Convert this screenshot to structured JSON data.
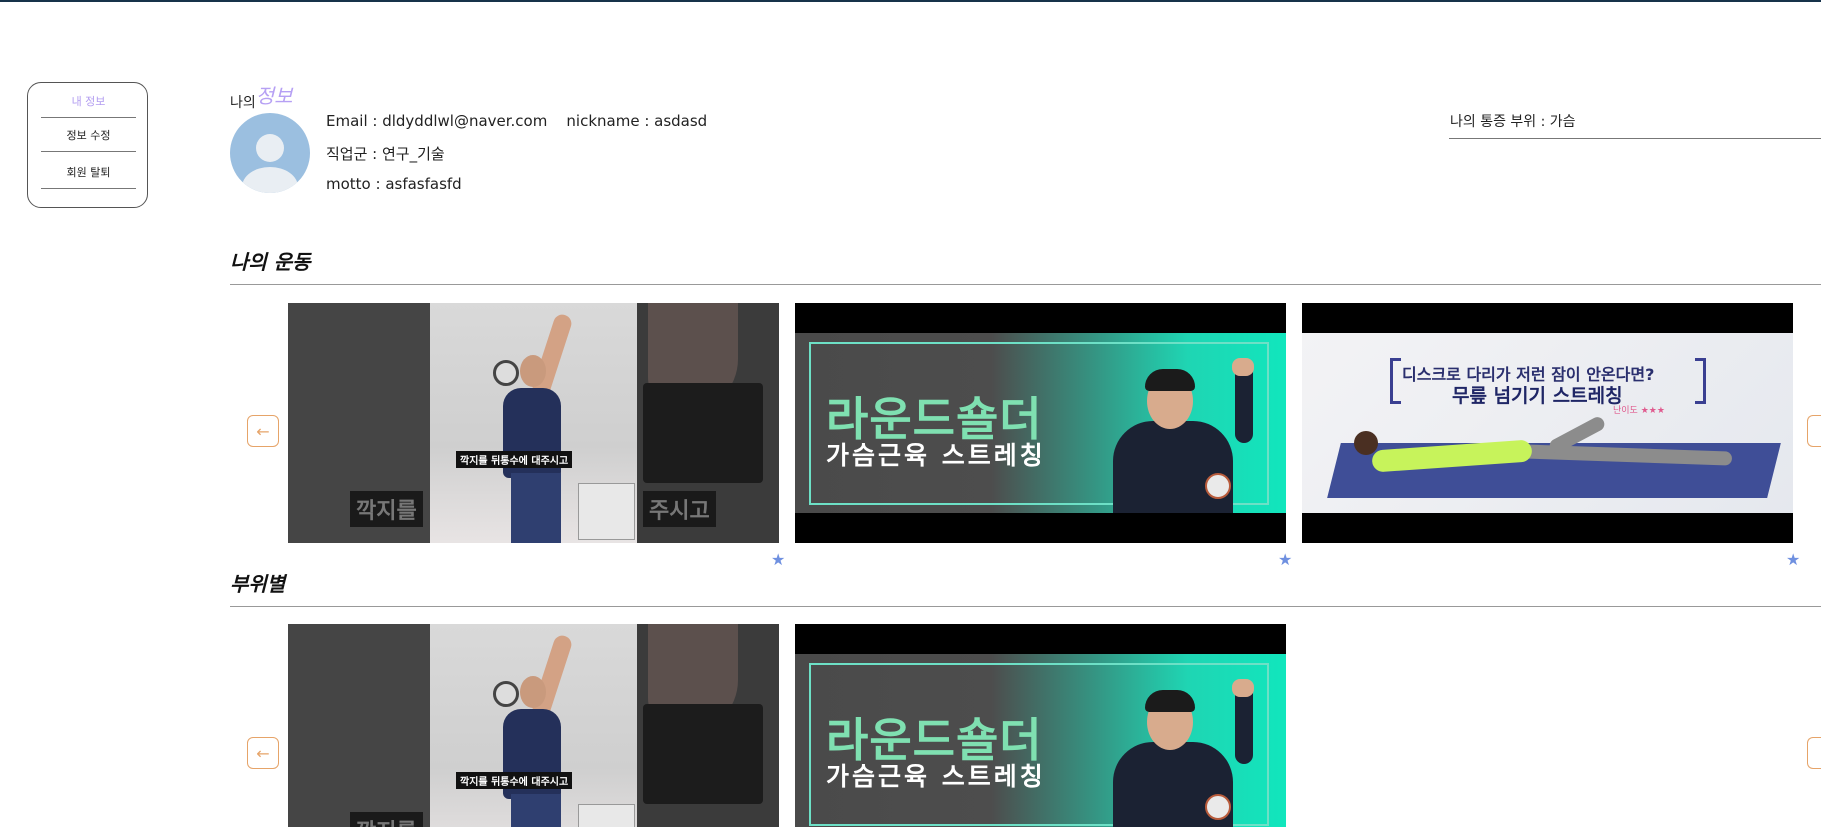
{
  "sidebar": {
    "items": [
      {
        "label": "내 정보",
        "active": true
      },
      {
        "label": "정보 수정",
        "active": false
      },
      {
        "label": "회원 탈퇴",
        "active": false
      }
    ]
  },
  "profile": {
    "heading_prefix": "나의",
    "heading_accent": "정보",
    "email_line": "Email : dldyddlwl@naver.com    nickname : asdasd",
    "job_line": "직업군 : 연구_기술",
    "motto_line": "motto : asfasfasfd",
    "pain_area": "나의 통증 부위 : 가슴"
  },
  "sections": {
    "my_exercise_title": "나의 운동",
    "by_part_title": "부위별"
  },
  "thumbnails": {
    "a_subtitle": "깍지를 뒤통수에 대주시고",
    "a_ghost_left": "깍지를",
    "a_ghost_right": "주시고",
    "b_title": "라운드숄더",
    "b_subtitle": "가슴근육 스트레칭",
    "c_title1": "디스크로 다리가 저런 잠이 안온다면?",
    "c_title2": "무릎 넘기기 스트레칭",
    "c_level": "난이도 ★★★"
  },
  "icons": {
    "prev_arrow": "←",
    "next_arrow": "→",
    "star": "★"
  },
  "colors": {
    "accent_purple": "#b6a0f4",
    "arrow_orange": "#e6a469",
    "star_blue": "#6f90e0"
  }
}
